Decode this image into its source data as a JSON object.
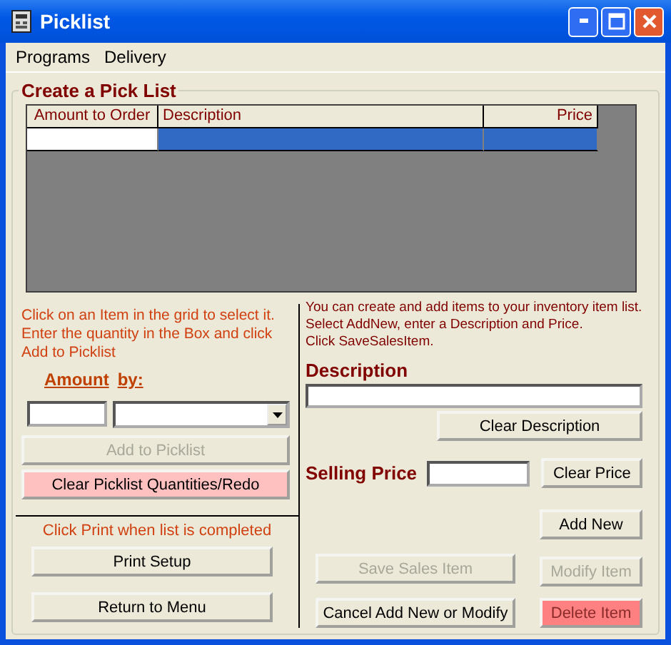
{
  "window": {
    "title": "Picklist"
  },
  "menu": [
    {
      "label": "Programs"
    },
    {
      "label": "Delivery"
    }
  ],
  "group": {
    "title": "Create a Pick List"
  },
  "grid": {
    "columns": [
      "Amount to Order",
      "Description",
      "Price"
    ],
    "rows": [
      {
        "selected": true
      }
    ]
  },
  "picklist": {
    "instructions": [
      "Click on an Item in the grid to select it.",
      "Enter the quantity in the Box and click",
      "Add to Picklist"
    ],
    "amount_label": "Amount",
    "by_label": "by:",
    "buttons": [
      {
        "label": "Add to Picklist",
        "disabled": true
      },
      {
        "label": "Clear Picklist Quantities/Redo",
        "disabled": false,
        "color": "#ffc0c0"
      }
    ],
    "print_note": "Click Print when list is completed",
    "bottom_buttons": [
      {
        "label": "Print Setup",
        "disabled": false
      },
      {
        "label": "Return to Menu",
        "disabled": false
      }
    ]
  },
  "sales_item": {
    "instructions": [
      "You can create and add items to your inventory item list.",
      "Select AddNew, enter a Description and Price.",
      "Click SaveSalesItem."
    ],
    "description_label": "Description",
    "clear_description": {
      "label": "Clear Description",
      "disabled": false
    },
    "price_label": "Selling Price",
    "clear_price": {
      "label": "Clear Price",
      "disabled": false
    },
    "add_new": {
      "label": "Add New",
      "disabled": false
    },
    "save": {
      "label": "Save Sales Item",
      "disabled": true
    },
    "modify": {
      "label": "Modify Item",
      "disabled": true
    },
    "cancel": {
      "label": "Cancel Add New or Modify",
      "disabled": false
    },
    "delete": {
      "label": "Delete Item",
      "disabled": true,
      "color": "#ff8080"
    }
  }
}
